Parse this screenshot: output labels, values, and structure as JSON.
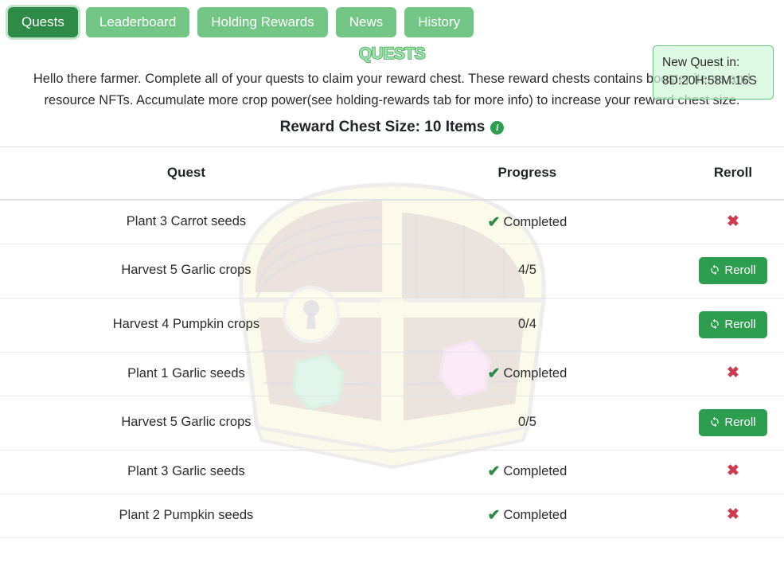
{
  "tabs": [
    {
      "label": "Quests",
      "active": true
    },
    {
      "label": "Leaderboard",
      "active": false
    },
    {
      "label": "Holding Rewards",
      "active": false
    },
    {
      "label": "News",
      "active": false
    },
    {
      "label": "History",
      "active": false
    }
  ],
  "header": {
    "title": "QUESTS",
    "description": "Hello there farmer. Complete all of your quests to claim your reward chest. These reward chests contains booster items and resource NFTs. Accumulate more crop power(see holding-rewards tab for more info) to increase your reward chest size.",
    "chest_size_label": "Reward Chest Size: 10 Items",
    "info_icon_glyph": "i"
  },
  "quest_timer": {
    "label": "New Quest in:",
    "value": "8D:20H:58M:16S"
  },
  "table": {
    "columns": [
      "Quest",
      "Progress",
      "Reroll"
    ],
    "rows": [
      {
        "quest": "Plant 3 Carrot seeds",
        "progress": "Completed",
        "completed": true,
        "action": "cancel",
        "action_label": "✖"
      },
      {
        "quest": "Harvest 5 Garlic crops",
        "progress": "4/5",
        "completed": false,
        "action": "reroll",
        "action_label": "Reroll"
      },
      {
        "quest": "Harvest 4 Pumpkin crops",
        "progress": "0/4",
        "completed": false,
        "action": "reroll",
        "action_label": "Reroll"
      },
      {
        "quest": "Plant 1 Garlic seeds",
        "progress": "Completed",
        "completed": true,
        "action": "cancel",
        "action_label": "✖"
      },
      {
        "quest": "Harvest 5 Garlic crops",
        "progress": "0/5",
        "completed": false,
        "action": "reroll",
        "action_label": "Reroll"
      },
      {
        "quest": "Plant 3 Garlic seeds",
        "progress": "Completed",
        "completed": true,
        "action": "cancel",
        "action_label": "✖"
      },
      {
        "quest": "Plant 2 Pumpkin seeds",
        "progress": "Completed",
        "completed": true,
        "action": "cancel",
        "action_label": "✖"
      }
    ]
  },
  "icons": {
    "check": "✔",
    "close": "✖",
    "reroll": "sync-icon",
    "background": "treasure-chest-watermark"
  },
  "colors": {
    "tab_active": "#2d8a47",
    "tab_inactive": "#74c686",
    "reroll_button": "#2d9e4f",
    "check_green": "#2d8a47",
    "x_red": "#cf3b4e",
    "badge_border": "#63c47c",
    "title_fill": "#9be3a8",
    "title_stroke": "#4aa35f"
  }
}
